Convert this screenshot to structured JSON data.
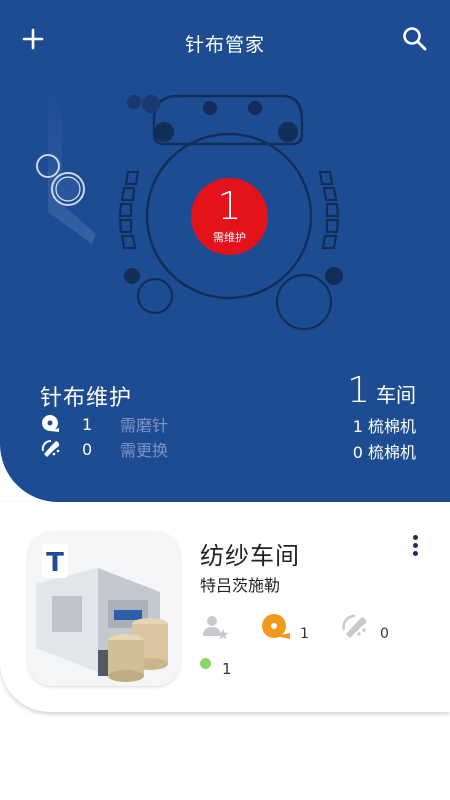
{
  "header": {
    "title": "针布管家"
  },
  "status_badge": {
    "count": "1",
    "label": "需维护"
  },
  "maintenance": {
    "title": "针布维护",
    "grind": {
      "count": "1",
      "label": "需磨针"
    },
    "replace": {
      "count": "0",
      "label": "需更换"
    }
  },
  "workshops": {
    "count": "1",
    "unit": "车间",
    "carding_line_1": "1 梳棉机",
    "carding_line_2": "0 梳棉机"
  },
  "workshop_card": {
    "title": "纺纱车间",
    "subtitle": "特吕茨施勒",
    "logo_letter": "T",
    "grind_count": "1",
    "replace_count": "0",
    "active_count": "1"
  },
  "colors": {
    "hero_blue": "#1e4c93",
    "alert_red": "#e3121b",
    "grind_orange": "#f39a1d",
    "active_green": "#8fd46c"
  },
  "icons": {
    "add": "plus-icon",
    "search": "search-icon",
    "grind": "grind-icon",
    "replace": "wrench-icon",
    "user_rate": "user-star-icon",
    "more": "kebab-icon"
  }
}
